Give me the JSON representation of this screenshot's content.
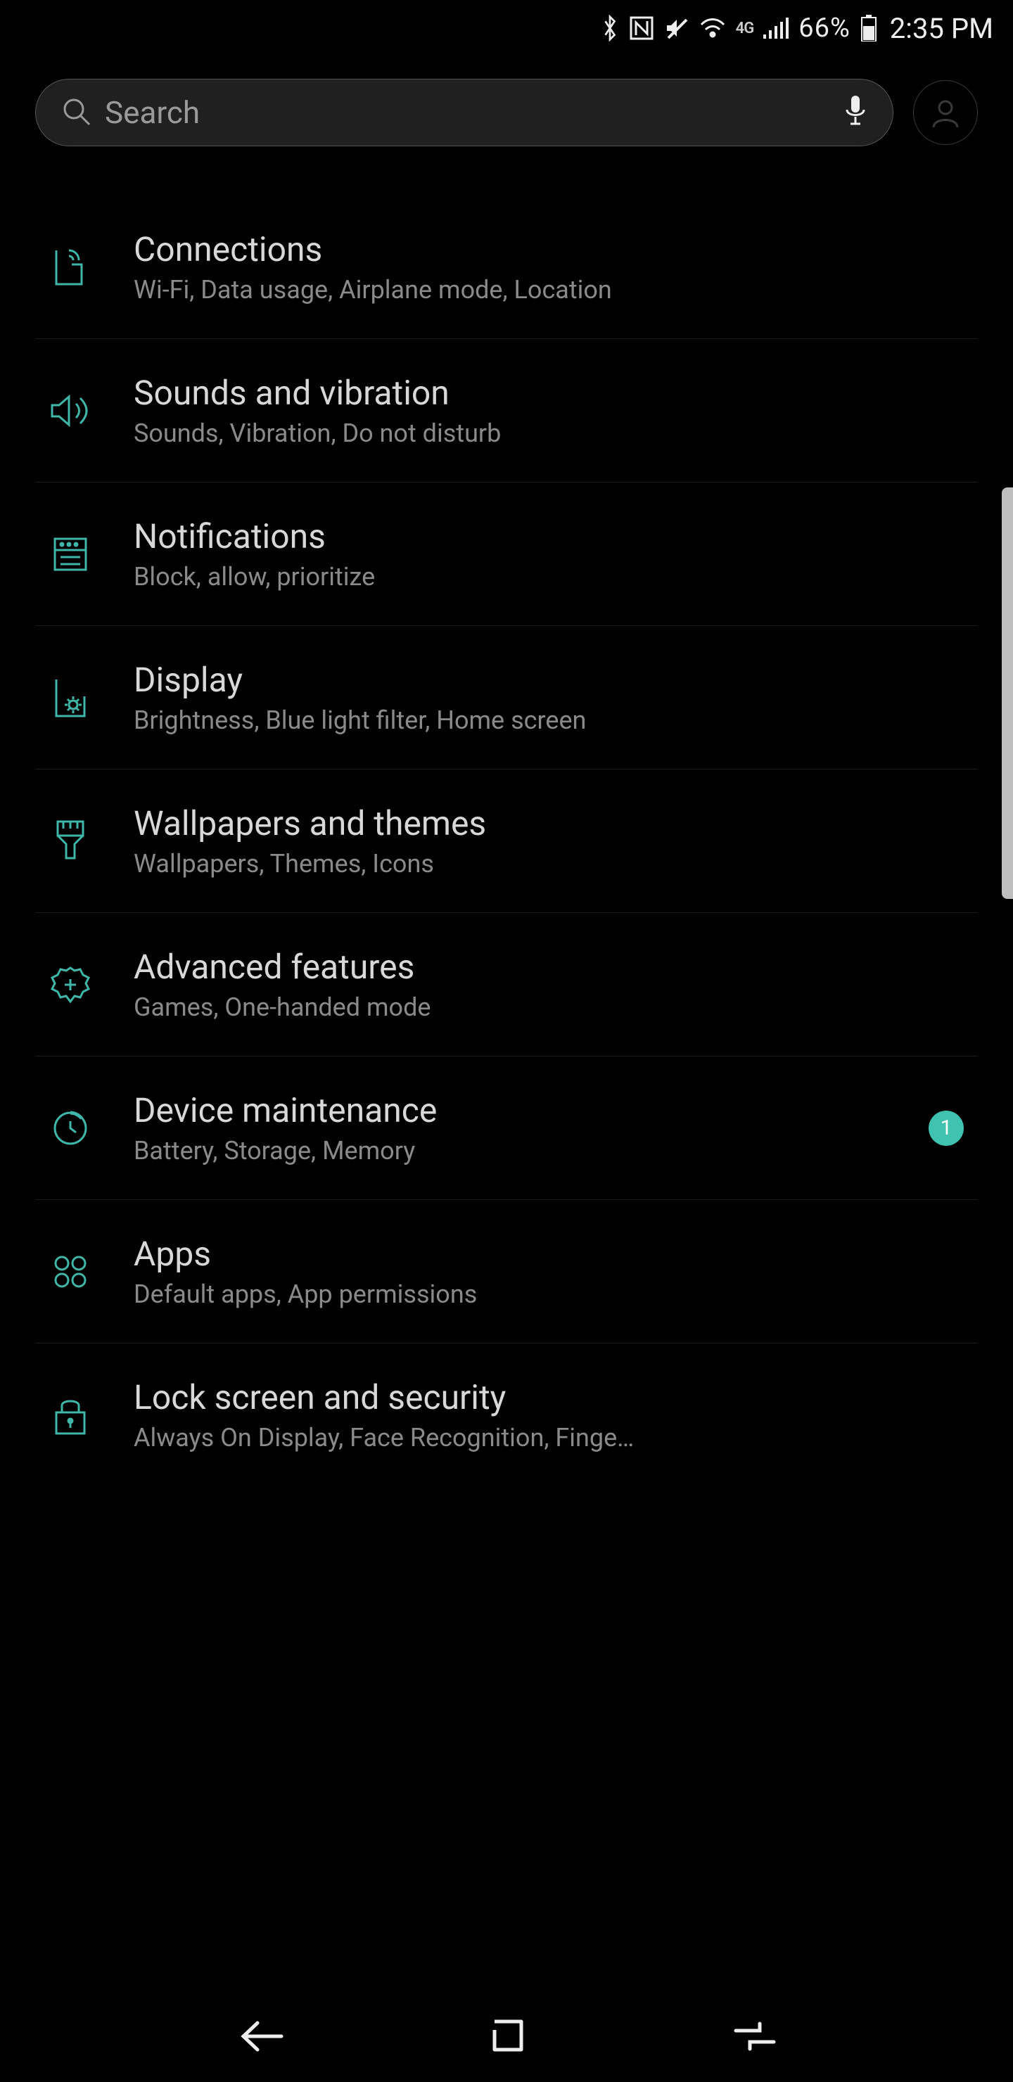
{
  "status_bar": {
    "battery_text": "66%",
    "time": "2:35 PM",
    "network_label": "4G"
  },
  "search": {
    "placeholder": "Search"
  },
  "settings": [
    {
      "id": "connections",
      "title": "Connections",
      "subtitle": "Wi-Fi, Data usage, Airplane mode, Location"
    },
    {
      "id": "sounds",
      "title": "Sounds and vibration",
      "subtitle": "Sounds, Vibration, Do not disturb"
    },
    {
      "id": "notifications",
      "title": "Notifications",
      "subtitle": "Block, allow, prioritize"
    },
    {
      "id": "display",
      "title": "Display",
      "subtitle": "Brightness, Blue light filter, Home screen"
    },
    {
      "id": "wallpapers",
      "title": "Wallpapers and themes",
      "subtitle": "Wallpapers, Themes, Icons"
    },
    {
      "id": "advanced",
      "title": "Advanced features",
      "subtitle": "Games, One-handed mode"
    },
    {
      "id": "maintenance",
      "title": "Device maintenance",
      "subtitle": "Battery, Storage, Memory",
      "badge": "1"
    },
    {
      "id": "apps",
      "title": "Apps",
      "subtitle": "Default apps, App permissions"
    },
    {
      "id": "lockscreen",
      "title": "Lock screen and security",
      "subtitle": "Always On Display, Face Recognition, Finge…"
    }
  ]
}
